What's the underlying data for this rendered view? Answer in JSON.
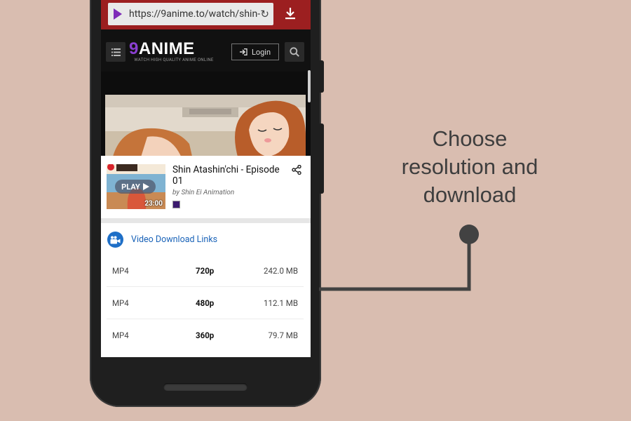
{
  "browser": {
    "url": "https://9anime.to/watch/shin-",
    "reload_icon": "reload-icon",
    "download_icon": "download-icon"
  },
  "site": {
    "logo_number": "9",
    "logo_word": "ANIME",
    "logo_tagline": "WATCH HIGH QUALITY ANIME ONLINE",
    "login_label": "Login",
    "menu_icon": "list-icon",
    "search_icon": "search-icon"
  },
  "video": {
    "title": "Shin Atashin'chi - Episode 01",
    "author": "by Shin Ei Animation",
    "play_label": "PLAY",
    "duration": "23:00"
  },
  "downloads": {
    "header": "Video Download Links",
    "rows": [
      {
        "format": "MP4",
        "resolution": "720p",
        "size": "242.0 MB"
      },
      {
        "format": "MP4",
        "resolution": "480p",
        "size": "112.1 MB"
      },
      {
        "format": "MP4",
        "resolution": "360p",
        "size": "79.7 MB"
      }
    ]
  },
  "annotation": {
    "line1": "Choose",
    "line2": "resolution and",
    "line3": "download"
  },
  "colors": {
    "background": "#d9bdb0",
    "browser_bar": "#9c1f20",
    "brand_purple": "#8a3fd1",
    "link_blue": "#1a63b8"
  }
}
